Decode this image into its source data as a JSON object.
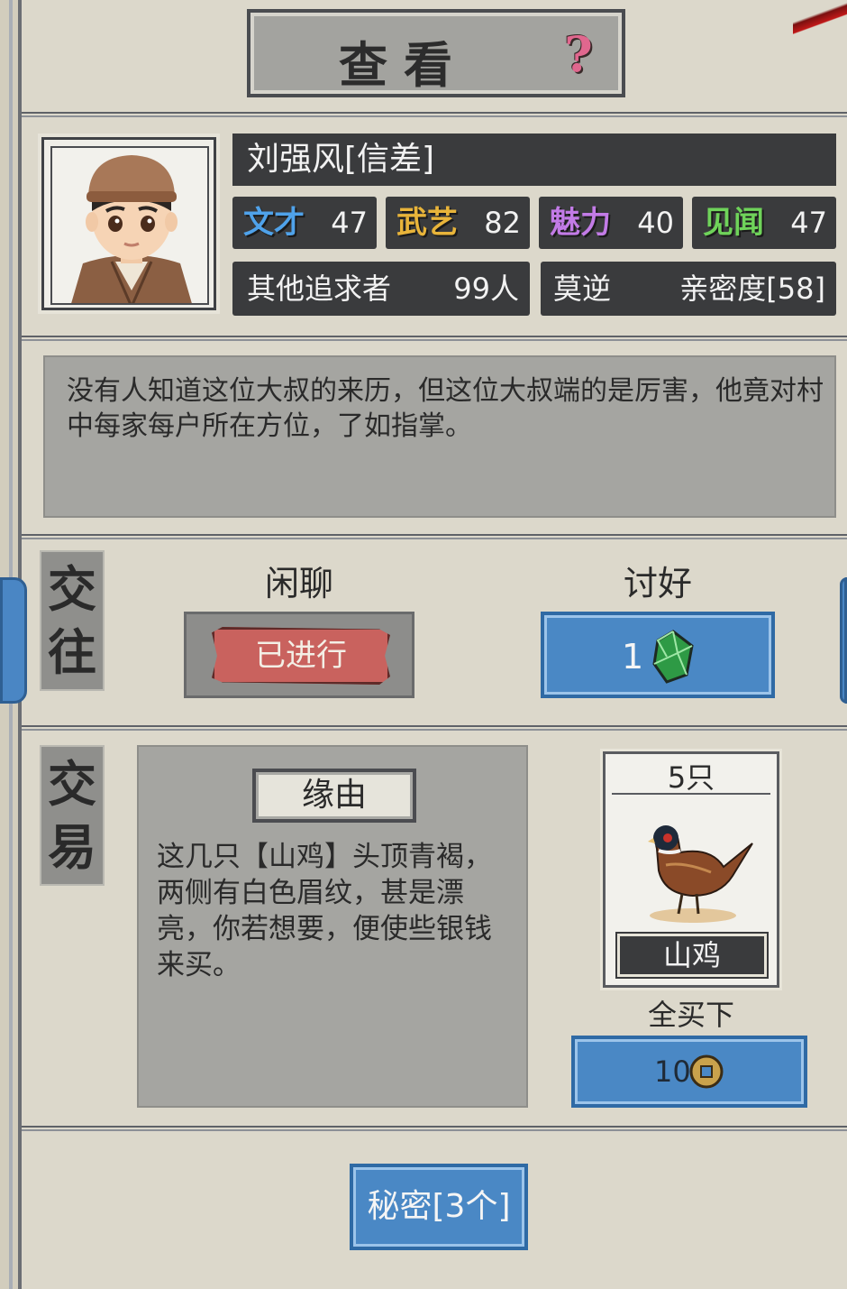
{
  "header": {
    "title": "查看",
    "help_symbol": "?"
  },
  "character": {
    "name": "刘强风[信差]",
    "stats": [
      {
        "label": "文才",
        "value": "47",
        "color": "#4fa2ea"
      },
      {
        "label": "武艺",
        "value": "82",
        "color": "#e8b43a"
      },
      {
        "label": "魅力",
        "value": "40",
        "color": "#c27be6"
      },
      {
        "label": "见闻",
        "value": "47",
        "color": "#6fd35a"
      }
    ],
    "suitors_label": "其他追求者",
    "suitors_value": "99人",
    "relation_label": "莫逆",
    "intimacy": "亲密度[58]"
  },
  "description": "没有人知道这位大叔的来历，但这位大叔端的是厉害，他竟对村中每家每户所在方位，了如指掌。",
  "interaction": {
    "section_label": [
      "交",
      "往"
    ],
    "chat_label": "闲聊",
    "chat_button": "已进行",
    "flatter_label": "讨好",
    "flatter_cost": "1",
    "flatter_cost_icon": "jade-gem-icon"
  },
  "trade": {
    "section_label": [
      "交",
      "易"
    ],
    "reason_label": "缘由",
    "reason_text": "这几只【山鸡】头顶青褐，两侧有白色眉纹，甚是漂亮，你若想要，便使些银钱来买。",
    "item_count": "5只",
    "item_name": "山鸡",
    "item_icon": "pheasant-icon",
    "buy_all_label": "全买下",
    "price": "10",
    "price_icon": "copper-coin-icon"
  },
  "secrets_button": "秘密[3个]"
}
